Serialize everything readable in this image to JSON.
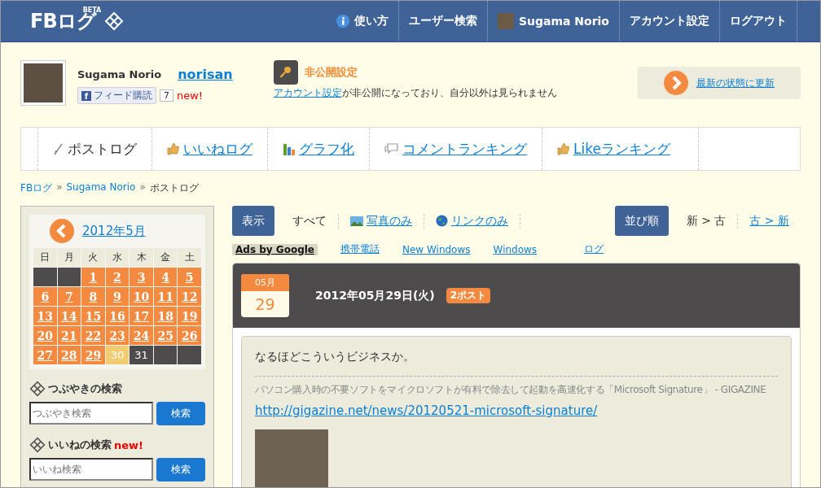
{
  "header": {
    "logo": "FBログ",
    "beta": "BETA",
    "menu": [
      {
        "kind": "help",
        "label": "使い方"
      },
      {
        "kind": "text",
        "label": "ユーザー検索"
      },
      {
        "kind": "user",
        "label": "Sugama Norio"
      },
      {
        "kind": "text",
        "label": "アカウント設定"
      },
      {
        "kind": "text",
        "label": "ログアウト"
      }
    ]
  },
  "profile": {
    "name": "Sugama Norio",
    "username": "norisan",
    "feed_icon": "f",
    "feed_button": "フィード購読",
    "feed_count": "7",
    "new_badge": "new!"
  },
  "privacy": {
    "title": "非公開設定",
    "link": "アカウント設定",
    "message": "が非公開になっており、自分以外は見られません"
  },
  "refresh": {
    "label": "最新の状態に更新"
  },
  "tabs": [
    {
      "kind": "posts",
      "label": "ポストログ",
      "selected": true
    },
    {
      "kind": "likes",
      "label": "いいねログ",
      "selected": false
    },
    {
      "kind": "graph",
      "label": "グラフ化",
      "selected": false
    },
    {
      "kind": "comments",
      "label": "コメントランキング",
      "selected": false
    },
    {
      "kind": "likes",
      "label": "Likeランキング",
      "selected": false
    }
  ],
  "breadcrumb": [
    {
      "kind": "link",
      "label": "FBログ"
    },
    {
      "kind": "separator",
      "label": "»"
    },
    {
      "kind": "link",
      "label": "Sugama Norio"
    },
    {
      "kind": "separator",
      "label": "»"
    },
    {
      "kind": "current",
      "label": "ポストログ"
    }
  ],
  "calendar": {
    "month": "2012年5月",
    "weekdays": [
      "日",
      "月",
      "火",
      "水",
      "木",
      "金",
      "土"
    ],
    "days": [
      {
        "kind": "empty"
      },
      {
        "kind": "empty"
      },
      {
        "kind": "posts",
        "label": "1"
      },
      {
        "kind": "posts",
        "label": "2"
      },
      {
        "kind": "posts",
        "label": "3"
      },
      {
        "kind": "posts",
        "label": "4"
      },
      {
        "kind": "posts",
        "label": "5"
      },
      {
        "kind": "posts",
        "label": "6"
      },
      {
        "kind": "posts",
        "label": "7"
      },
      {
        "kind": "posts",
        "label": "8"
      },
      {
        "kind": "posts",
        "label": "9"
      },
      {
        "kind": "posts",
        "label": "10"
      },
      {
        "kind": "posts",
        "label": "11"
      },
      {
        "kind": "posts",
        "label": "12"
      },
      {
        "kind": "posts",
        "label": "13"
      },
      {
        "kind": "posts",
        "label": "14"
      },
      {
        "kind": "posts",
        "label": "15"
      },
      {
        "kind": "posts",
        "label": "16"
      },
      {
        "kind": "posts",
        "label": "17"
      },
      {
        "kind": "posts",
        "label": "18"
      },
      {
        "kind": "posts",
        "label": "19"
      },
      {
        "kind": "posts",
        "label": "20"
      },
      {
        "kind": "posts",
        "label": "21"
      },
      {
        "kind": "posts",
        "label": "22"
      },
      {
        "kind": "posts",
        "label": "23"
      },
      {
        "kind": "posts",
        "label": "24"
      },
      {
        "kind": "posts",
        "label": "25"
      },
      {
        "kind": "posts",
        "label": "26"
      },
      {
        "kind": "posts",
        "label": "27"
      },
      {
        "kind": "posts",
        "label": "28"
      },
      {
        "kind": "posts",
        "label": "29"
      },
      {
        "kind": "today",
        "label": "30"
      },
      {
        "kind": "plain",
        "label": "31"
      },
      {
        "kind": "empty"
      },
      {
        "kind": "empty"
      }
    ]
  },
  "searches": [
    {
      "title": "つぶやきの検索",
      "placeholder": "つぶやき検索",
      "button": "検索"
    },
    {
      "title": "いいねの検索",
      "new_badge": "new!",
      "placeholder": "いいね検索",
      "button": "検索"
    }
  ],
  "filter": {
    "label": "表示",
    "options": [
      {
        "kind": "all",
        "label": "すべて",
        "selected": true
      },
      {
        "kind": "photos",
        "label": "写真のみ",
        "selected": false
      },
      {
        "kind": "links",
        "label": "リンクのみ",
        "selected": false
      }
    ]
  },
  "sort": {
    "label": "並び順",
    "options": [
      {
        "label": "新 > 古",
        "selected": true
      },
      {
        "label": "古 > 新",
        "selected": false
      }
    ]
  },
  "ads": {
    "label": "Ads by Google",
    "links": [
      "携帯電話",
      "New Windows",
      "Windows",
      "ログ"
    ]
  },
  "day": {
    "month": "05月",
    "date": "29",
    "title": "2012年05月29日(火)",
    "count": "2ポスト"
  },
  "post": {
    "text": "なるほどこういうビジネスか。",
    "link_title": "パソコン購入時の不要ソフトをマイクロソフトが有料で除去して起動を高速化する「Microsoft Signature」 - GIGAZINE",
    "url": "http://gigazine.net/news/20120521-microsoft-signature/"
  }
}
